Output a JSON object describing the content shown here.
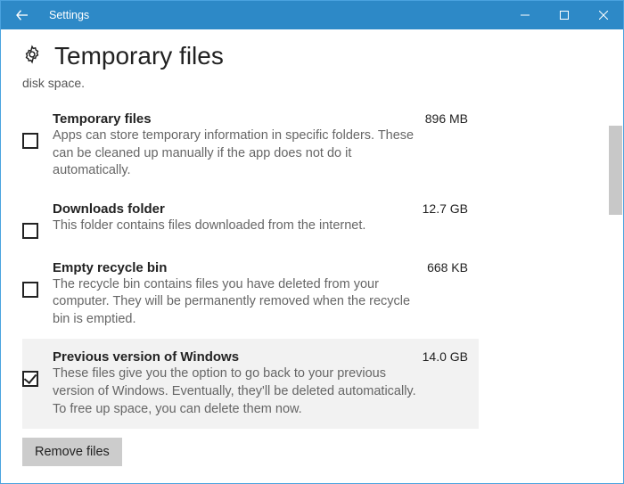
{
  "window": {
    "app_title": "Settings"
  },
  "page": {
    "title": "Temporary files",
    "truncated_line": "disk space."
  },
  "items": [
    {
      "title": "Temporary files",
      "size": "896 MB",
      "desc": "Apps can store temporary information in specific folders. These can be cleaned up manually if the app does not do it automatically.",
      "checked": false
    },
    {
      "title": "Downloads folder",
      "size": "12.7 GB",
      "desc": "This folder contains files downloaded from the internet.",
      "checked": false
    },
    {
      "title": "Empty recycle bin",
      "size": "668 KB",
      "desc": "The recycle bin contains files you have deleted from your computer. They will be permanently removed when the recycle bin is emptied.",
      "checked": false
    },
    {
      "title": "Previous version of Windows",
      "size": "14.0 GB",
      "desc": "These files give you the option to go back to your previous version of Windows. Eventually, they'll be deleted automatically. To free up space, you can delete them now.",
      "checked": true
    }
  ],
  "actions": {
    "remove_label": "Remove files"
  }
}
